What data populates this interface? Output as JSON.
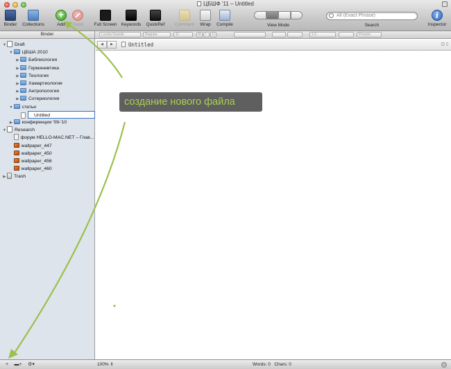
{
  "window": {
    "title": "ЦБШФ '11 – Untitled"
  },
  "toolbar": {
    "binder": "Binder",
    "collections": "Collections",
    "add": "Add",
    "trash": "Trash",
    "full_screen": "Full Screen",
    "keywords": "Keywords",
    "quickref": "QuickRef",
    "comment": "Comment",
    "wrap": "Wrap",
    "compile": "Compile",
    "view_mode": "View Mode",
    "search_placeholder": "All (Exact Phrase)",
    "search": "Search",
    "inspector": "Inspector"
  },
  "format_bar": {
    "font": "Lucida Grande",
    "style": "Regular",
    "size": "11",
    "bold": "B",
    "italic": "I",
    "underline": "U",
    "spacing": "1.0",
    "presets": "Presets"
  },
  "binder": {
    "header": "Binder",
    "items": [
      {
        "label": "Draft",
        "icon": "draft-icon",
        "level": 0,
        "expanded": true
      },
      {
        "label": "ЦБША 2010",
        "icon": "folder-icon",
        "level": 1,
        "expanded": true
      },
      {
        "label": "Библиология",
        "icon": "folder-icon",
        "level": 2,
        "expanded": false
      },
      {
        "label": "Герминевтика",
        "icon": "folder-icon",
        "level": 2,
        "expanded": false
      },
      {
        "label": "Теология",
        "icon": "folder-icon",
        "level": 2,
        "expanded": false
      },
      {
        "label": "Хамартиология",
        "icon": "folder-icon",
        "level": 2,
        "expanded": false
      },
      {
        "label": "Антропология",
        "icon": "folder-icon",
        "level": 2,
        "expanded": false
      },
      {
        "label": "Сотериология",
        "icon": "folder-icon",
        "level": 2,
        "expanded": false
      },
      {
        "label": "статьи",
        "icon": "folder-icon",
        "level": 1,
        "expanded": true
      },
      {
        "label": "Untitled",
        "icon": "document-icon",
        "level": 2,
        "selected": true
      },
      {
        "label": "конференции '09-'10",
        "icon": "folder-icon",
        "level": 1,
        "expanded": false
      },
      {
        "label": "Research",
        "icon": "research-icon",
        "level": 0,
        "expanded": true
      },
      {
        "label": "форум HELLO-MAC.NET – Глав...",
        "icon": "web-page-icon",
        "level": 1
      },
      {
        "label": "wallpaper_447",
        "icon": "image-icon",
        "level": 1
      },
      {
        "label": "wallpaper_450",
        "icon": "image-icon",
        "level": 1
      },
      {
        "label": "wallpaper_456",
        "icon": "image-icon",
        "level": 1
      },
      {
        "label": "wallpaper_460",
        "icon": "image-icon",
        "level": 1
      },
      {
        "label": "Trash",
        "icon": "trash-icon",
        "level": 0,
        "expanded": false
      }
    ]
  },
  "editor": {
    "doc_title": "Untitled"
  },
  "status": {
    "zoom": "100%",
    "words": "Words: 0",
    "chars": "Chars: 0"
  },
  "annotation": {
    "text": "создание нового файла",
    "color": "#a9d250"
  },
  "colors": {
    "sidebar_bg": "#dde4ec",
    "selection_border": "#3a6fc2",
    "arrow": "#9bc04c"
  }
}
